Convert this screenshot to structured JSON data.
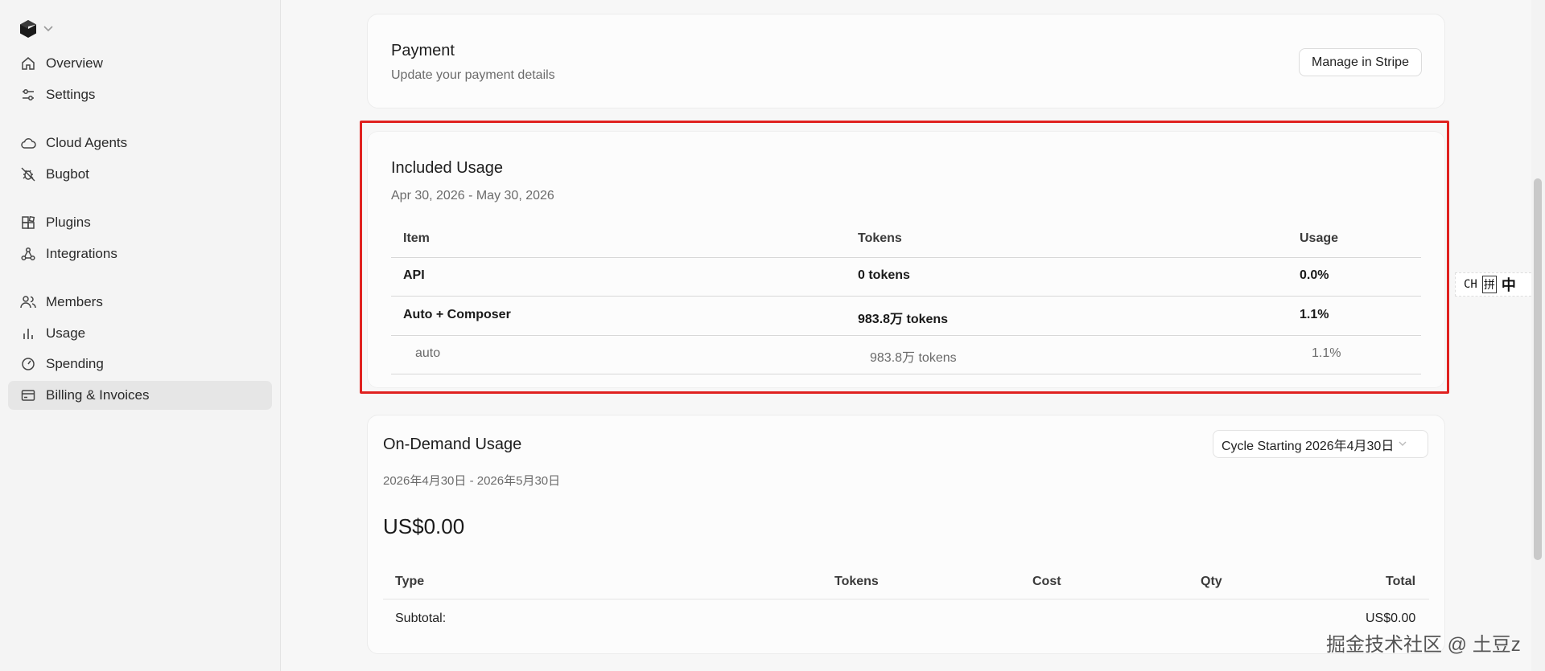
{
  "sidebar": {
    "items": [
      {
        "label": "Overview",
        "icon": "home-icon"
      },
      {
        "label": "Settings",
        "icon": "sliders-icon"
      },
      {
        "label": "Cloud Agents",
        "icon": "cloud-icon"
      },
      {
        "label": "Bugbot",
        "icon": "bug-icon"
      },
      {
        "label": "Plugins",
        "icon": "plugin-icon"
      },
      {
        "label": "Integrations",
        "icon": "integrations-icon"
      },
      {
        "label": "Members",
        "icon": "members-icon"
      },
      {
        "label": "Usage",
        "icon": "bar-chart-icon"
      },
      {
        "label": "Spending",
        "icon": "gauge-icon"
      },
      {
        "label": "Billing & Invoices",
        "icon": "card-icon"
      }
    ],
    "active": "Billing & Invoices"
  },
  "payment": {
    "title": "Payment",
    "subtitle": "Update your payment details",
    "button": "Manage in Stripe"
  },
  "included": {
    "title": "Included Usage",
    "date_range": "Apr 30, 2026 - May 30, 2026",
    "headers": [
      "Item",
      "Tokens",
      "Usage"
    ],
    "rows": [
      {
        "item": "API",
        "tokens": "0 tokens",
        "usage": "0.0%"
      },
      {
        "item": "Auto + Composer",
        "tokens": "983.8万 tokens",
        "usage": "1.1%"
      }
    ],
    "sub_rows": [
      {
        "item": "auto",
        "tokens": "983.8万 tokens",
        "usage": "1.1%"
      }
    ]
  },
  "ondemand": {
    "title": "On-Demand Usage",
    "date_range": "2026年4月30日 - 2026年5月30日",
    "total": "US$0.00",
    "cycle_select": "Cycle Starting 2026年4月30日",
    "headers": [
      "Type",
      "Tokens",
      "Cost",
      "Qty",
      "Total"
    ],
    "subtotal_label": "Subtotal:",
    "subtotal_value": "US$0.00"
  },
  "ime": {
    "mode": "CH",
    "pinyin": "拼",
    "zh": "中"
  },
  "watermark": "掘金技术社区 @ 土豆z",
  "colors": {
    "highlight": "#e0211f",
    "active_nav": "#e6e6e6"
  }
}
